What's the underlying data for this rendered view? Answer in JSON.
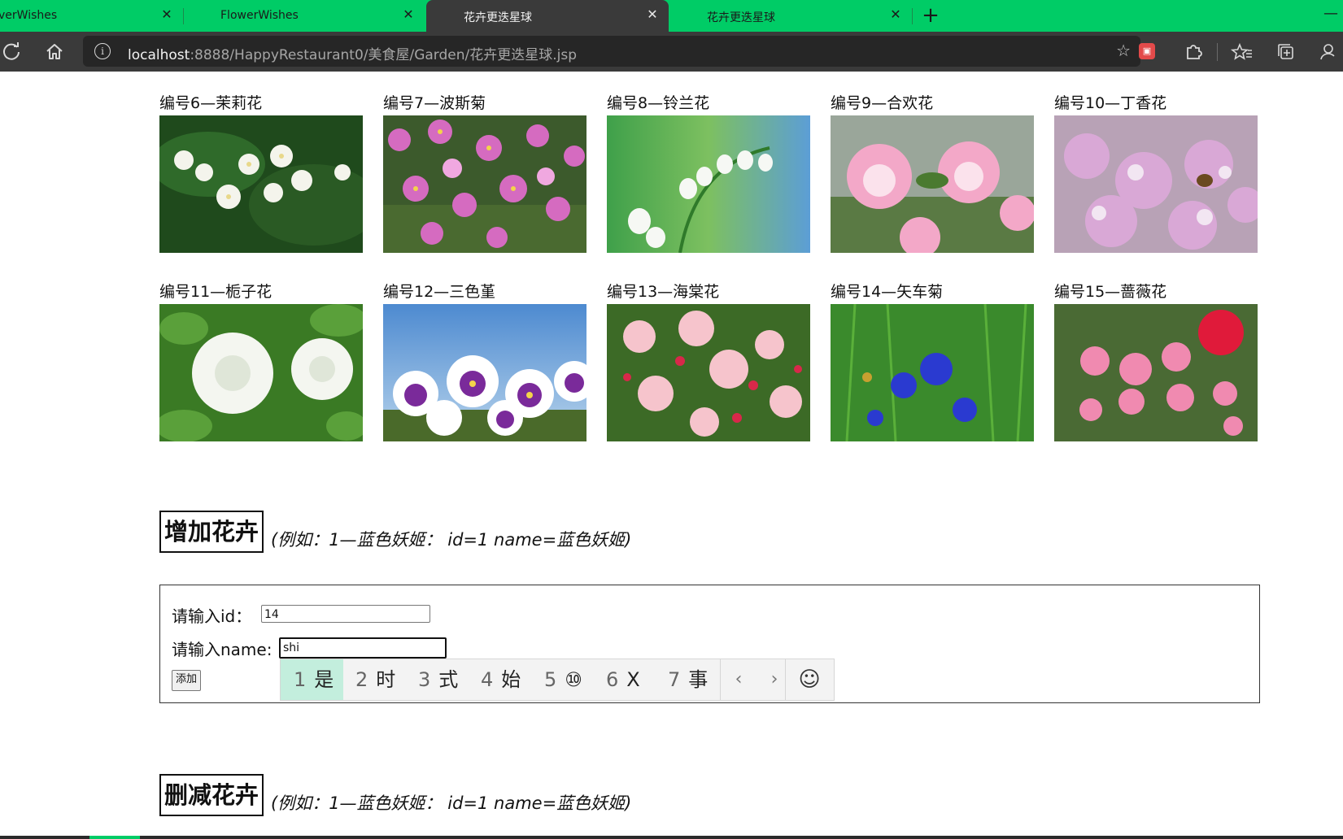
{
  "browser": {
    "tabs": [
      {
        "label": "verWishes",
        "active": false
      },
      {
        "label": "FlowerWishes",
        "active": false
      },
      {
        "label": "花卉更迭星球",
        "active": true
      },
      {
        "label": "花卉更迭星球",
        "active": false
      }
    ],
    "url_host": "localhost",
    "url_path": ":8888/HappyRestaurant0/美食屋/Garden/花卉更迭星球.jsp",
    "accent_color": "#00cc66",
    "toolbar_color": "#3a3a3a"
  },
  "flowers": [
    {
      "caption": "编号6—茉莉花"
    },
    {
      "caption": "编号7—波斯菊"
    },
    {
      "caption": "编号8—铃兰花"
    },
    {
      "caption": "编号9—合欢花"
    },
    {
      "caption": "编号10—丁香花"
    },
    {
      "caption": "编号11—栀子花"
    },
    {
      "caption": "编号12—三色堇"
    },
    {
      "caption": "编号13—海棠花"
    },
    {
      "caption": "编号14—矢车菊"
    },
    {
      "caption": "编号15—蔷薇花"
    }
  ],
  "add_section": {
    "title": "增加花卉",
    "hint": "(例如：1—蓝色妖姬：  id=1 name=蓝色妖姬)",
    "id_label": "请输入id：",
    "id_value": "14",
    "name_label": "请输入name:",
    "name_value": "shi",
    "button_label": "添加"
  },
  "ime": {
    "candidates": [
      {
        "num": "1",
        "text": "是"
      },
      {
        "num": "2",
        "text": "时"
      },
      {
        "num": "3",
        "text": "式"
      },
      {
        "num": "4",
        "text": "始"
      },
      {
        "num": "5",
        "text": "⑩"
      },
      {
        "num": "6",
        "text": "X"
      },
      {
        "num": "7",
        "text": "事"
      }
    ],
    "prev": "‹",
    "next": "›",
    "emoji": "☺"
  },
  "delete_section": {
    "title": "删减花卉",
    "hint": "(例如：1—蓝色妖姬：  id=1 name=蓝色妖姬)"
  }
}
